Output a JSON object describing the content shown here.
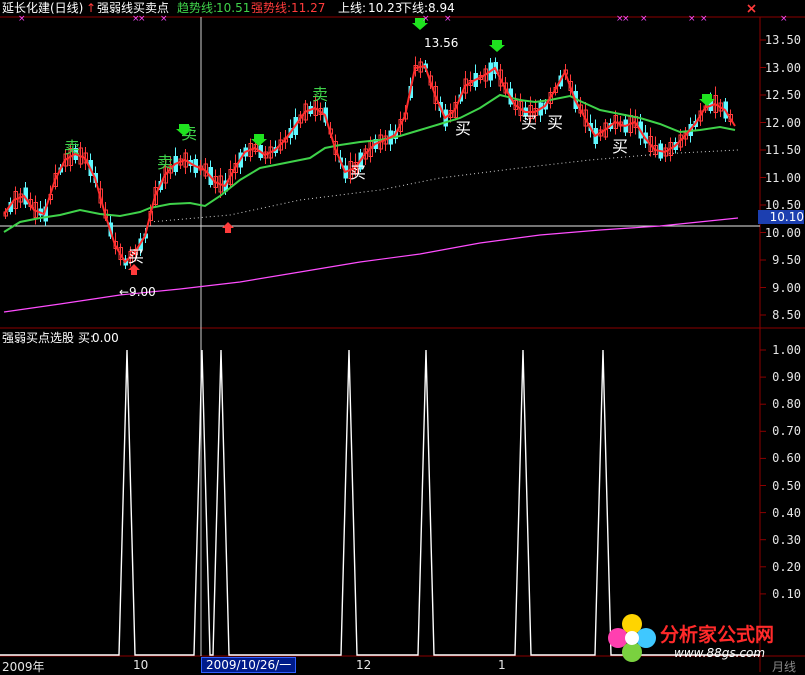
{
  "header": {
    "stock_name": "延长化建(日线)",
    "indicator_name": "强弱线买卖点",
    "trend_label": "趋势线:",
    "trend_value": "10.51",
    "strong_label": "强势线:",
    "strong_value": "11.27",
    "upper_label": "上线:",
    "upper_value": "10.23",
    "lower_label": "下线:",
    "lower_value": "8.94"
  },
  "lower_panel": {
    "title": "强弱买点选股",
    "buy_label": "买:",
    "buy_value": "0.00"
  },
  "signals": {
    "buy": "买",
    "sell": "卖"
  },
  "annotations": {
    "high": "13.56",
    "low": "←9.00",
    "current_price": "10.10"
  },
  "price_axis": [
    "13.50",
    "13.00",
    "12.50",
    "12.00",
    "11.50",
    "11.00",
    "10.50",
    "10.00",
    "9.50",
    "9.00",
    "8.50"
  ],
  "signal_axis": [
    "1.00",
    "0.90",
    "0.80",
    "0.70",
    "0.60",
    "0.50",
    "0.40",
    "0.30",
    "0.20",
    "0.10"
  ],
  "x_axis": {
    "labels": [
      "2009年",
      "10",
      "2009/10/26/一",
      "12",
      "1",
      "月线"
    ]
  },
  "logo": {
    "text": "分析家公式网",
    "url": "www.88gs.com"
  },
  "colors": {
    "background": "#000000",
    "grid": "#8b0000",
    "rising": "#ff3b3b",
    "falling": "#5ff8ff",
    "trend_line": "#3fd24a",
    "strong_line": "#ff2d2d",
    "long_line": "#ff4dff",
    "signal_line": "#ffffff"
  },
  "icons": {
    "sell_arrow": "green-down-arrow-icon",
    "buy_arrow": "red-up-arrow-icon",
    "window_close": "close-x-icon"
  }
}
